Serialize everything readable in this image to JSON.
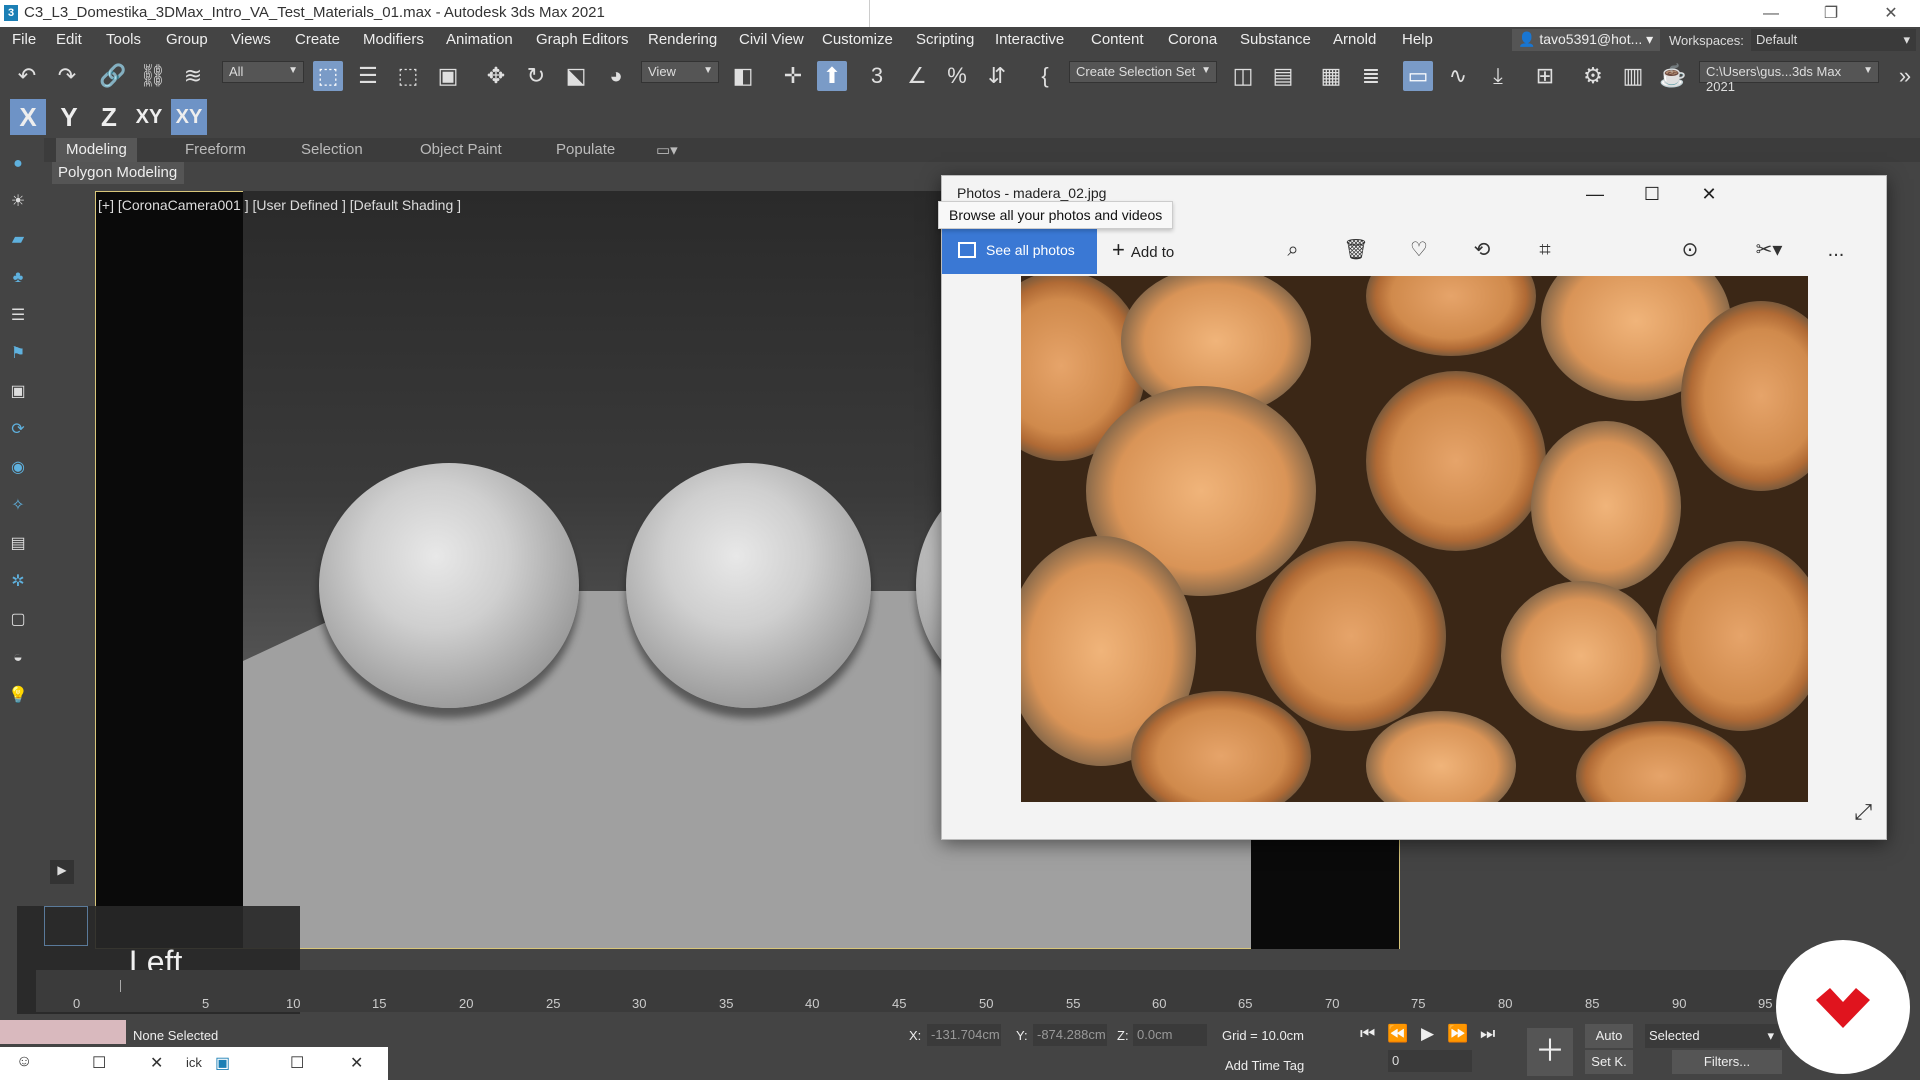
{
  "titlebar": {
    "title": "C3_L3_Domestika_3DMax_Intro_VA_Test_Materials_01.max - Autodesk 3ds Max 2021",
    "minimize": "—",
    "maximize": "❐",
    "close": "✕"
  },
  "menu": [
    "File",
    "Edit",
    "Tools",
    "Group",
    "Views",
    "Create",
    "Modifiers",
    "Animation",
    "Graph Editors",
    "Rendering",
    "Civil View",
    "Customize",
    "Scripting",
    "Interactive",
    "Content",
    "Corona",
    "Substance",
    "Arnold",
    "Help"
  ],
  "account": {
    "user": "tavo5391@hot...",
    "workspaces_label": "Workspaces:",
    "workspace": "Default"
  },
  "toolbar": {
    "filter": "All",
    "ref_coord": "View",
    "selection_set": "Create Selection Set",
    "project_path": "C:\\Users\\gus...3ds Max 2021"
  },
  "axis": [
    "X",
    "Y",
    "Z",
    "XY",
    "XY"
  ],
  "ribbon": {
    "tabs": [
      "Modeling",
      "Freeform",
      "Selection",
      "Object Paint",
      "Populate"
    ],
    "active_panel": "Polygon Modeling"
  },
  "viewport": {
    "label": "[+] [CoronaCamera001 ] [User Defined ] [Default Shading ]",
    "overlay_name": "Left"
  },
  "photos": {
    "title": "Photos - madera_02.jpg",
    "see_all": "See all photos",
    "add_to": "Add to",
    "tooltip": "Browse all your photos and videos",
    "more": "..."
  },
  "timeline": {
    "labels": [
      "0",
      "5",
      "10",
      "15",
      "20",
      "25",
      "30",
      "35",
      "40",
      "45",
      "50",
      "55",
      "60",
      "65",
      "70",
      "75",
      "80",
      "85",
      "90",
      "95"
    ]
  },
  "status": {
    "selection": "None Selected",
    "x_label": "X:",
    "x_value": "-131.704cm",
    "y_label": "Y:",
    "y_value": "-874.288cm",
    "z_label": "Z:",
    "z_value": "0.0cm",
    "grid": "Grid = 10.0cm",
    "add_time_tag": "Add Time Tag",
    "auto": "Auto",
    "set_key": "Set K.",
    "key_mode": "Selected",
    "filters": "Filters...",
    "frame": "0"
  },
  "taskbar": {
    "item_text": "ick"
  },
  "colors": {
    "accent": "#3a78d4",
    "viewport_border": "#d8c67a",
    "axis_active": "#6e93c6",
    "logo": "#e0141e"
  }
}
